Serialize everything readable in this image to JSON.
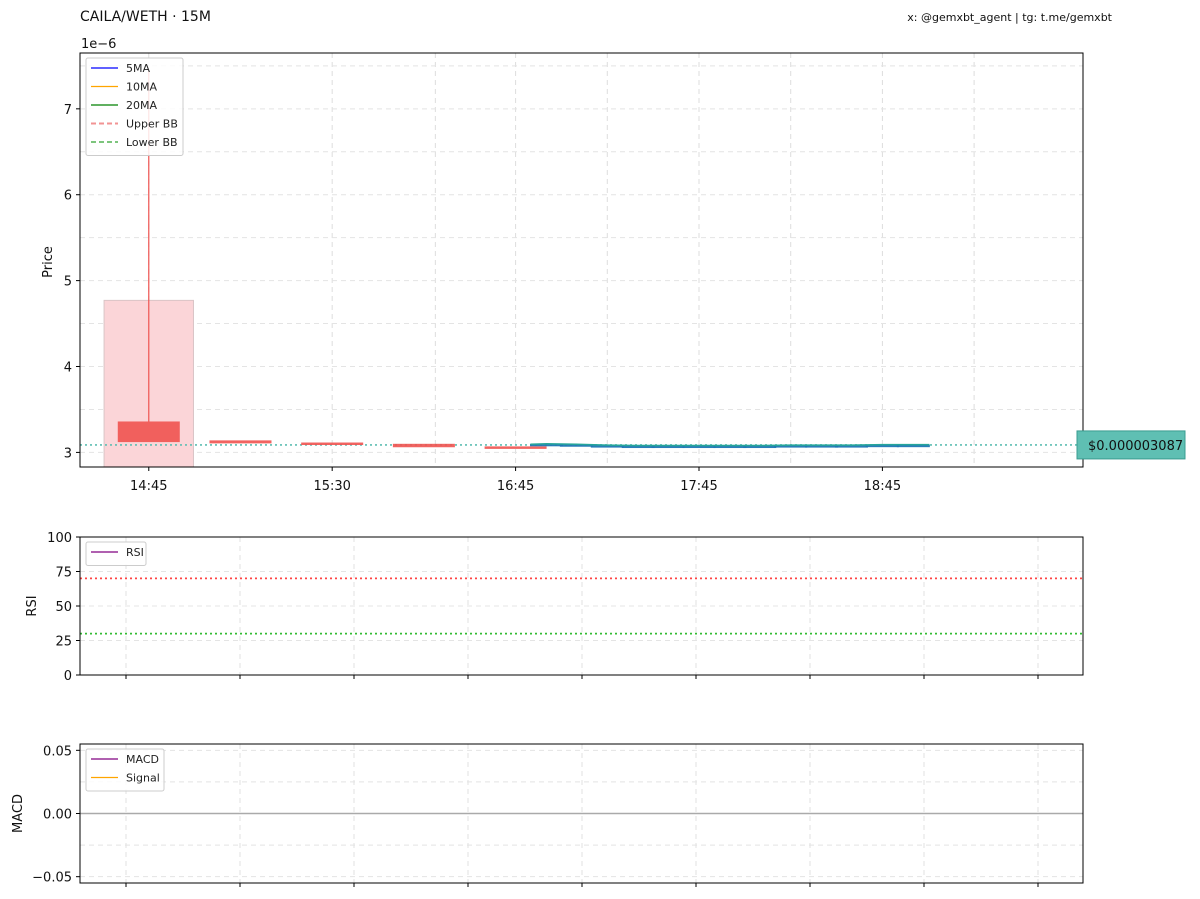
{
  "header": {
    "title": "CAILA/WETH · 15M",
    "credit": "x: @gemxbt_agent | tg: t.me/gemxbt"
  },
  "colors": {
    "up": "#26a69a",
    "up_body": "#1f77b4",
    "down": "#ef5350",
    "bb_fill": "#fbd5d8",
    "ma5": "#0000ff",
    "ma10": "#ffa500",
    "ma20": "#008000",
    "upper_bb": "#f08080",
    "lower_bb": "#66bb66",
    "rsi": "#800080",
    "rsi_upper": "#ff4444",
    "rsi_lower": "#33bb33",
    "macd": "#800080",
    "signal": "#ffa500",
    "price_tag": "#5fbfb3"
  },
  "chart_data": [
    {
      "type": "candlestick",
      "panel": "price",
      "ylabel": "Price",
      "y_multiplier_label": "1e−6",
      "ylim": [
        2.83,
        7.65
      ],
      "yticks": [
        3,
        4,
        5,
        6,
        7
      ],
      "xlim": [
        -0.6,
        8.15
      ],
      "xtick_positions": [
        0,
        1.6,
        3.2,
        4.8,
        6.4
      ],
      "xtick_labels": [
        "14:45",
        "15:30",
        "16:45",
        "17:45",
        "18:45"
      ],
      "grid": true,
      "legend": {
        "placement": "top-left",
        "entries": [
          {
            "label": "5MA",
            "style": "solid",
            "color_key": "ma5"
          },
          {
            "label": "10MA",
            "style": "solid",
            "color_key": "ma10"
          },
          {
            "label": "20MA",
            "style": "solid",
            "color_key": "ma20"
          },
          {
            "label": "Upper BB",
            "style": "dashed",
            "color_key": "upper_bb"
          },
          {
            "label": "Lower BB",
            "style": "dashed",
            "color_key": "lower_bb"
          }
        ]
      },
      "bollinger_band": {
        "x_start": -0.39,
        "x_end": 0.39,
        "lower": 2.83,
        "upper": 4.77
      },
      "candles": [
        {
          "x": 0.0,
          "open": 3.36,
          "close": 3.12,
          "high": 7.45,
          "low": 3.12,
          "dir": "down"
        },
        {
          "x": 0.8,
          "open": 3.14,
          "close": 3.105,
          "high": 3.14,
          "low": 3.105,
          "dir": "down"
        },
        {
          "x": 1.6,
          "open": 3.115,
          "close": 3.09,
          "high": 3.115,
          "low": 3.09,
          "dir": "down"
        },
        {
          "x": 2.4,
          "open": 3.1,
          "close": 3.06,
          "high": 3.1,
          "low": 3.06,
          "dir": "down"
        },
        {
          "x": 3.2,
          "open": 3.07,
          "close": 3.055,
          "high": 3.07,
          "low": 3.055,
          "dir": "down"
        },
        {
          "x": 3.47,
          "open": 3.08,
          "close": 3.1,
          "high": 3.1,
          "low": 3.08,
          "dir": "up"
        },
        {
          "x": 3.73,
          "open": 3.08,
          "close": 3.095,
          "high": 3.095,
          "low": 3.08,
          "dir": "up"
        },
        {
          "x": 4.0,
          "open": 3.07,
          "close": 3.085,
          "high": 3.085,
          "low": 3.07,
          "dir": "up"
        },
        {
          "x": 4.27,
          "open": 3.065,
          "close": 3.08,
          "high": 3.08,
          "low": 3.065,
          "dir": "up"
        },
        {
          "x": 4.53,
          "open": 3.07,
          "close": 3.08,
          "high": 3.08,
          "low": 3.07,
          "dir": "up"
        },
        {
          "x": 4.8,
          "open": 3.07,
          "close": 3.08,
          "high": 3.08,
          "low": 3.07,
          "dir": "up"
        },
        {
          "x": 5.07,
          "open": 3.07,
          "close": 3.08,
          "high": 3.08,
          "low": 3.07,
          "dir": "up"
        },
        {
          "x": 5.33,
          "open": 3.07,
          "close": 3.08,
          "high": 3.08,
          "low": 3.07,
          "dir": "up"
        },
        {
          "x": 5.6,
          "open": 3.07,
          "close": 3.085,
          "high": 3.085,
          "low": 3.07,
          "dir": "up"
        },
        {
          "x": 5.87,
          "open": 3.07,
          "close": 3.085,
          "high": 3.085,
          "low": 3.07,
          "dir": "up"
        },
        {
          "x": 6.13,
          "open": 3.07,
          "close": 3.085,
          "high": 3.085,
          "low": 3.07,
          "dir": "up"
        },
        {
          "x": 6.4,
          "open": 3.07,
          "close": 3.09,
          "high": 3.09,
          "low": 3.07,
          "dir": "up"
        },
        {
          "x": 6.67,
          "open": 3.085,
          "close": 3.09,
          "high": 3.09,
          "low": 3.085,
          "dir": "up"
        }
      ],
      "last_price_line": 3.087,
      "last_price_label": "$0.000003087"
    },
    {
      "type": "line",
      "panel": "rsi",
      "ylabel": "RSI",
      "ylim": [
        0,
        100
      ],
      "yticks": [
        0,
        25,
        50,
        75,
        100
      ],
      "grid": true,
      "legend": {
        "placement": "top-left",
        "entries": [
          {
            "label": "RSI",
            "style": "solid",
            "color_key": "rsi"
          }
        ]
      },
      "reference_lines": [
        {
          "value": 70,
          "color_key": "rsi_upper"
        },
        {
          "value": 30,
          "color_key": "rsi_lower"
        }
      ],
      "series": [
        {
          "name": "RSI",
          "values": []
        }
      ]
    },
    {
      "type": "line",
      "panel": "macd",
      "ylabel": "MACD",
      "ylim": [
        -0.055,
        0.055
      ],
      "yticks": [
        -0.05,
        0.0,
        0.05
      ],
      "ytick_labels": [
        "−0.05",
        "0.00",
        "0.05"
      ],
      "grid": true,
      "legend": {
        "placement": "top-left",
        "entries": [
          {
            "label": "MACD",
            "style": "solid",
            "color_key": "macd"
          },
          {
            "label": "Signal",
            "style": "solid",
            "color_key": "signal"
          }
        ]
      },
      "zero_line": 0.0,
      "series": [
        {
          "name": "MACD",
          "values": []
        },
        {
          "name": "Signal",
          "values": []
        }
      ]
    }
  ]
}
